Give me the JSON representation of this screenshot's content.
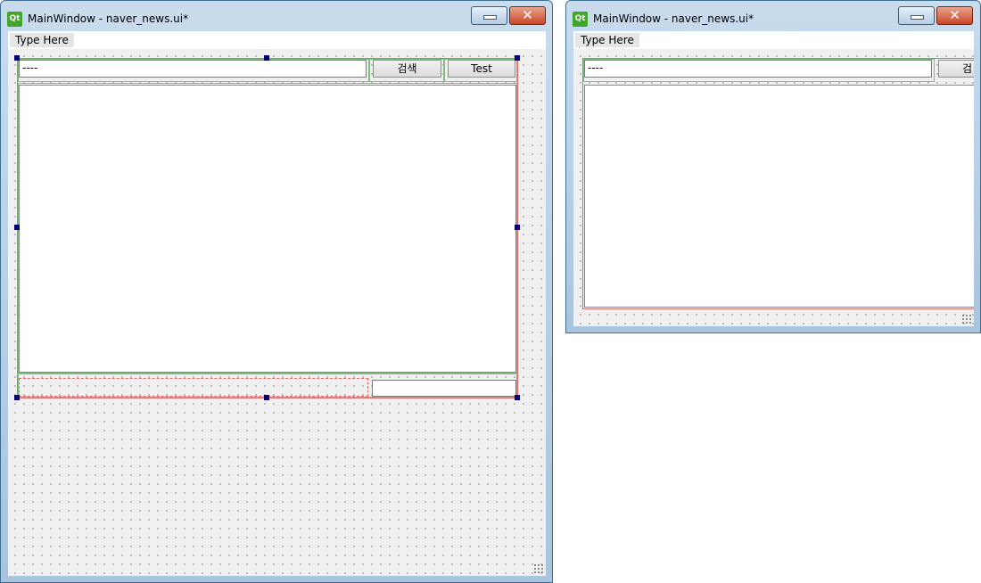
{
  "windows": [
    {
      "title": "MainWindow - naver_news.ui*",
      "menu": "Type Here",
      "line_edit_value": "----",
      "search_button": "검색",
      "test_button": "Test"
    },
    {
      "title": "MainWindow - naver_news.ui*",
      "menu": "Type Here",
      "line_edit_value": "----",
      "search_button": "검"
    }
  ],
  "icons": {
    "app": "qt-logo-icon",
    "minimize": "minimize-icon",
    "close": "close-icon",
    "resize": "size-grip-icon"
  },
  "colors": {
    "qt_logo": "#41a62a",
    "close_button": "#c94628",
    "layout_frame": "#e06b6b",
    "layout_cell": "#7fbf7f",
    "selection_handle": "#000080"
  }
}
